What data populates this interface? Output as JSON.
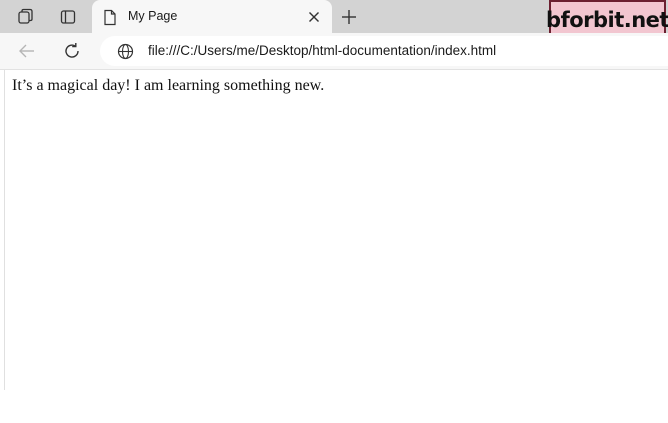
{
  "browser": {
    "tab": {
      "title": "My Page"
    },
    "address_bar": {
      "url": "file:///C:/Users/me/Desktop/html-documentation/index.html"
    },
    "icons": {
      "workspaces": "workspaces-icon",
      "tab_actions": "tab-actions-icon",
      "page": "page-icon",
      "close": "close-icon",
      "new_tab": "plus-icon",
      "back": "back-arrow-icon",
      "refresh": "refresh-icon",
      "site_info": "globe-icon"
    }
  },
  "watermark": {
    "text": "bforbit.net"
  },
  "page": {
    "paragraph": "It’s a magical day! I am learning something new."
  }
}
